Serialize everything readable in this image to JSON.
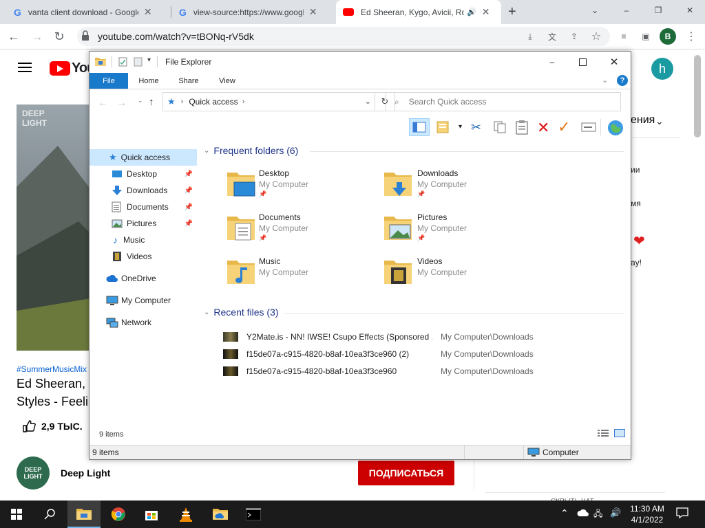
{
  "browser": {
    "tabs": [
      {
        "title": "vanta client download - Google S"
      },
      {
        "title": "view-source:https://www.google"
      },
      {
        "title": "Ed Sheeran, Kygo, Avicii, Rob"
      }
    ],
    "url": "youtube.com/watch?v=tBONq-rV5dk",
    "profile_initial": "B"
  },
  "youtube": {
    "logo_text": "You",
    "avatar_initial": "h",
    "video_watermark": "DEEP\nLIGHT",
    "hashtag": "#SummerMusicMix",
    "title_line1": "Ed Sheeran, K",
    "title_line2": "Styles - Feelin",
    "likes": "2,9 ТЫС.",
    "channel_name": "Deep Light",
    "channel_logo": "DEEP LIGHT",
    "subscribe_label": "ПОДПИСАТЬСЯ",
    "right_header": "ения",
    "right_text1": "ии",
    "right_text2": "мя",
    "right_text3": "ay!",
    "right_footer": "СКРЫТЬ ЧАТ"
  },
  "explorer": {
    "title": "File Explorer",
    "ribbon_tabs": [
      "File",
      "Home",
      "Share",
      "View"
    ],
    "address": "Quick access",
    "search_placeholder": "Search Quick access",
    "nav": [
      {
        "label": "Quick access",
        "icon": "star-icon",
        "pinned": false
      },
      {
        "label": "Desktop",
        "icon": "desktop-icon",
        "pinned": true
      },
      {
        "label": "Downloads",
        "icon": "download-icon",
        "pinned": true
      },
      {
        "label": "Documents",
        "icon": "document-icon",
        "pinned": true
      },
      {
        "label": "Pictures",
        "icon": "pictures-icon",
        "pinned": true
      },
      {
        "label": "Music",
        "icon": "music-icon",
        "pinned": false
      },
      {
        "label": "Videos",
        "icon": "videos-icon",
        "pinned": false
      },
      {
        "label": "OneDrive",
        "icon": "cloud-icon",
        "pinned": false
      },
      {
        "label": "My Computer",
        "icon": "computer-icon",
        "pinned": false
      },
      {
        "label": "Network",
        "icon": "network-icon",
        "pinned": false
      }
    ],
    "frequent_header": "Frequent folders (6)",
    "folders": [
      {
        "name": "Desktop",
        "location": "My Computer"
      },
      {
        "name": "Downloads",
        "location": "My Computer"
      },
      {
        "name": "Documents",
        "location": "My Computer"
      },
      {
        "name": "Pictures",
        "location": "My Computer"
      },
      {
        "name": "Music",
        "location": "My Computer"
      },
      {
        "name": "Videos",
        "location": "My Computer"
      }
    ],
    "recent_header": "Recent files (3)",
    "recent": [
      {
        "name": "Y2Mate.is - NN! IWSE! Csupo Effects (Sponsored ...",
        "path": "My Computer\\Downloads"
      },
      {
        "name": "f15de07a-c915-4820-b8af-10ea3f3ce960 (2)",
        "path": "My Computer\\Downloads"
      },
      {
        "name": "f15de07a-c915-4820-b8af-10ea3f3ce960",
        "path": "My Computer\\Downloads"
      }
    ],
    "item_count": "9 items",
    "status_items": "9 items",
    "status_location": "Computer"
  },
  "taskbar": {
    "time": "11:30 AM",
    "date": "4/1/2022"
  },
  "colors": {
    "yt_red": "#ff0000",
    "subscribe_red": "#cc0000",
    "explorer_blue": "#1979ca",
    "avatar_teal": "#1a9ba1"
  }
}
